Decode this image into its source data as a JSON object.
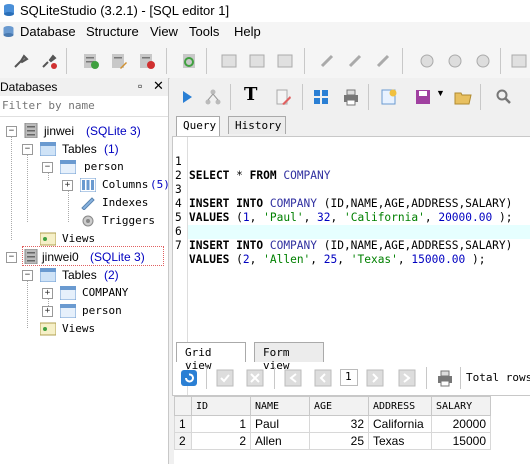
{
  "window": {
    "title": "SQLiteStudio (3.2.1) - [SQL editor 1]"
  },
  "menu": [
    {
      "label": "Database"
    },
    {
      "label": "Structure"
    },
    {
      "label": "View"
    },
    {
      "label": "Tools"
    },
    {
      "label": "Help"
    }
  ],
  "databases_panel": {
    "title": "Databases",
    "filter_placeholder": "Filter by name",
    "dock_icon": "restore-icon",
    "close_icon": "close-icon"
  },
  "tree": {
    "db1": {
      "name": "jinwei",
      "type": "(SQLite 3)"
    },
    "db1_tables": {
      "label": "Tables",
      "count": "(1)"
    },
    "db1_person": {
      "label": "person"
    },
    "db1_columns": {
      "label": "Columns",
      "count": "(5)"
    },
    "db1_indexes": {
      "label": "Indexes"
    },
    "db1_triggers": {
      "label": "Triggers"
    },
    "db1_views": {
      "label": "Views"
    },
    "db2": {
      "name": "jinwei0",
      "type": "(SQLite 3)"
    },
    "db2_tables": {
      "label": "Tables",
      "count": "(2)"
    },
    "db2_company": {
      "label": "COMPANY"
    },
    "db2_person": {
      "label": "person"
    },
    "db2_views": {
      "label": "Views"
    }
  },
  "editor_tabs": [
    {
      "label": "Query",
      "active": true
    },
    {
      "label": "History",
      "active": false
    }
  ],
  "code_lines": [
    {
      "n": "1",
      "text": "SELECT * FROM COMPANY"
    },
    {
      "n": "2",
      "text": ""
    },
    {
      "n": "3",
      "text": "INSERT INTO COMPANY (ID,NAME,AGE,ADDRESS,SALARY)"
    },
    {
      "n": "4",
      "text": "VALUES (1, 'Paul', 32, 'California', 20000.00 );"
    },
    {
      "n": "5",
      "text": ""
    },
    {
      "n": "6",
      "text": "INSERT INTO COMPANY (ID,NAME,AGE,ADDRESS,SALARY)"
    },
    {
      "n": "7",
      "text": "VALUES (2, 'Allen', 25, 'Texas', 15000.00 );"
    }
  ],
  "result_tabs": [
    {
      "label": "Grid view",
      "active": true
    },
    {
      "label": "Form view",
      "active": false
    }
  ],
  "result_toolbar": {
    "page": "1",
    "total_rows_label": "Total rows"
  },
  "grid": {
    "headers": [
      "ID",
      "NAME",
      "AGE",
      "ADDRESS",
      "SALARY"
    ],
    "rows": [
      {
        "rownum": "1",
        "ID": "1",
        "NAME": "Paul",
        "AGE": "32",
        "ADDRESS": "California",
        "SALARY": "20000"
      },
      {
        "rownum": "2",
        "ID": "2",
        "NAME": "Allen",
        "AGE": "25",
        "ADDRESS": "Texas",
        "SALARY": "15000"
      }
    ]
  },
  "colors": {
    "accent": "#0000c0",
    "string": "#008000",
    "highlight_line": "#e6ffff"
  }
}
